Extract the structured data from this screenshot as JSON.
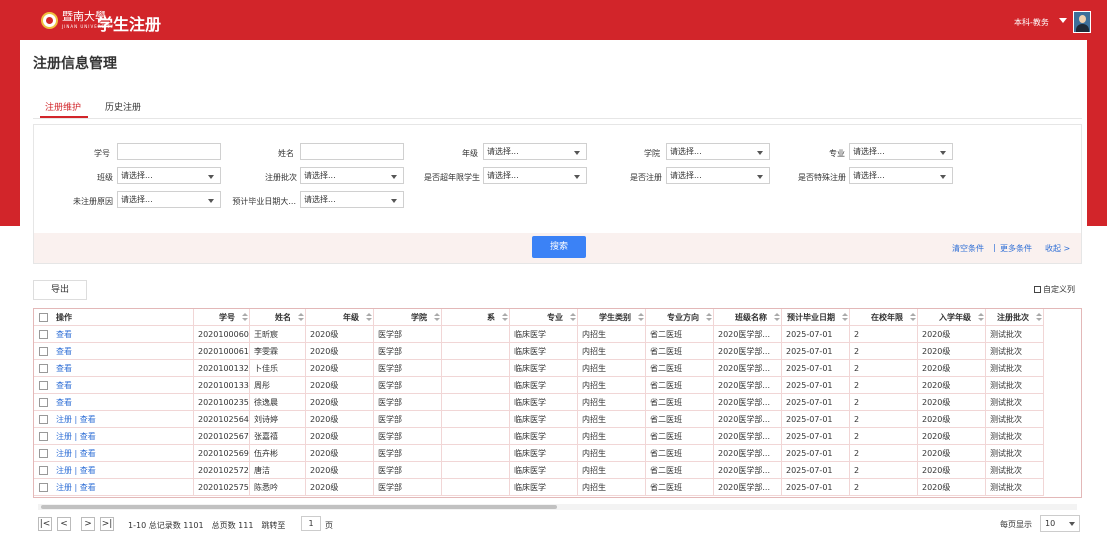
{
  "header": {
    "logo_text": "暨南大學",
    "logo_subtext": "JINAN UNIVERSITY",
    "app_title": "学生注册",
    "user_role": "本科-教务"
  },
  "page": {
    "title": "注册信息管理",
    "tabs": [
      {
        "label": "注册维护"
      },
      {
        "label": "历史注册"
      }
    ]
  },
  "filters": {
    "placeholder": "请选择...",
    "labels": {
      "student_id": "学号",
      "name": "姓名",
      "grade": "年级",
      "college": "学院",
      "major": "专业",
      "class": "班级",
      "batch": "注册批次",
      "over_limit": "是否超年限学生",
      "registered": "是否注册",
      "special": "是否特殊注册",
      "unregistered_reason": "未注册原因",
      "graduation_date": "预计毕业日期大..."
    },
    "search_button": "搜索",
    "clear_link": "清空条件",
    "more_link": "更多条件",
    "collapse_link": "收起 >"
  },
  "toolbar": {
    "export_label": "导出",
    "customize_label": "自定义列"
  },
  "table": {
    "columns": [
      "操作",
      "学号",
      "姓名",
      "年级",
      "学院",
      "系",
      "专业",
      "学生类别",
      "专业方向",
      "班级名称",
      "预计毕业日期",
      "在校年限",
      "入学年级",
      "注册批次"
    ],
    "rows": [
      {
        "actions": "查看",
        "id": "2020100060",
        "name": "王昕宸",
        "grade": "2020级",
        "college": "医学部",
        "dept": "",
        "major": "临床医学",
        "type": "内招生",
        "direction": "省二医班",
        "class": "2020医学部...",
        "grad_date": "2025-07-01",
        "years": "2",
        "entry": "2020级",
        "batch": "测试批次"
      },
      {
        "actions": "查看",
        "id": "2020100061",
        "name": "李雯霖",
        "grade": "2020级",
        "college": "医学部",
        "dept": "",
        "major": "临床医学",
        "type": "内招生",
        "direction": "省二医班",
        "class": "2020医学部...",
        "grad_date": "2025-07-01",
        "years": "2",
        "entry": "2020级",
        "batch": "测试批次"
      },
      {
        "actions": "查看",
        "id": "2020100132",
        "name": "卜佳乐",
        "grade": "2020级",
        "college": "医学部",
        "dept": "",
        "major": "临床医学",
        "type": "内招生",
        "direction": "省二医班",
        "class": "2020医学部...",
        "grad_date": "2025-07-01",
        "years": "2",
        "entry": "2020级",
        "batch": "测试批次"
      },
      {
        "actions": "查看",
        "id": "2020100133",
        "name": "周彤",
        "grade": "2020级",
        "college": "医学部",
        "dept": "",
        "major": "临床医学",
        "type": "内招生",
        "direction": "省二医班",
        "class": "2020医学部...",
        "grad_date": "2025-07-01",
        "years": "2",
        "entry": "2020级",
        "batch": "测试批次"
      },
      {
        "actions": "查看",
        "id": "2020100235",
        "name": "徐逸晨",
        "grade": "2020级",
        "college": "医学部",
        "dept": "",
        "major": "临床医学",
        "type": "内招生",
        "direction": "省二医班",
        "class": "2020医学部...",
        "grad_date": "2025-07-01",
        "years": "2",
        "entry": "2020级",
        "batch": "测试批次"
      },
      {
        "actions": "注册 | 查看",
        "id": "2020102564",
        "name": "刘诗婷",
        "grade": "2020级",
        "college": "医学部",
        "dept": "",
        "major": "临床医学",
        "type": "内招生",
        "direction": "省二医班",
        "class": "2020医学部...",
        "grad_date": "2025-07-01",
        "years": "2",
        "entry": "2020级",
        "batch": "测试批次"
      },
      {
        "actions": "注册 | 查看",
        "id": "2020102567",
        "name": "张嘉禧",
        "grade": "2020级",
        "college": "医学部",
        "dept": "",
        "major": "临床医学",
        "type": "内招生",
        "direction": "省二医班",
        "class": "2020医学部...",
        "grad_date": "2025-07-01",
        "years": "2",
        "entry": "2020级",
        "batch": "测试批次"
      },
      {
        "actions": "注册 | 查看",
        "id": "2020102569",
        "name": "伍卉彬",
        "grade": "2020级",
        "college": "医学部",
        "dept": "",
        "major": "临床医学",
        "type": "内招生",
        "direction": "省二医班",
        "class": "2020医学部...",
        "grad_date": "2025-07-01",
        "years": "2",
        "entry": "2020级",
        "batch": "测试批次"
      },
      {
        "actions": "注册 | 查看",
        "id": "2020102572",
        "name": "唐洁",
        "grade": "2020级",
        "college": "医学部",
        "dept": "",
        "major": "临床医学",
        "type": "内招生",
        "direction": "省二医班",
        "class": "2020医学部...",
        "grad_date": "2025-07-01",
        "years": "2",
        "entry": "2020级",
        "batch": "测试批次"
      },
      {
        "actions": "注册 | 查看",
        "id": "2020102575",
        "name": "陈悉吟",
        "grade": "2020级",
        "college": "医学部",
        "dept": "",
        "major": "临床医学",
        "type": "内招生",
        "direction": "省二医班",
        "class": "2020医学部...",
        "grad_date": "2025-07-01",
        "years": "2",
        "entry": "2020级",
        "batch": "测试批次"
      }
    ]
  },
  "pagination": {
    "info": "1-10 总记录数 1101　总页数 111　跳转至",
    "current_page": "1",
    "page_unit": "页",
    "per_page_label": "每页显示",
    "per_page_value": "10"
  },
  "colors": {
    "brand_red": "#d2252a",
    "link_blue": "#2f6fd6",
    "button_blue": "#3b82f6"
  }
}
